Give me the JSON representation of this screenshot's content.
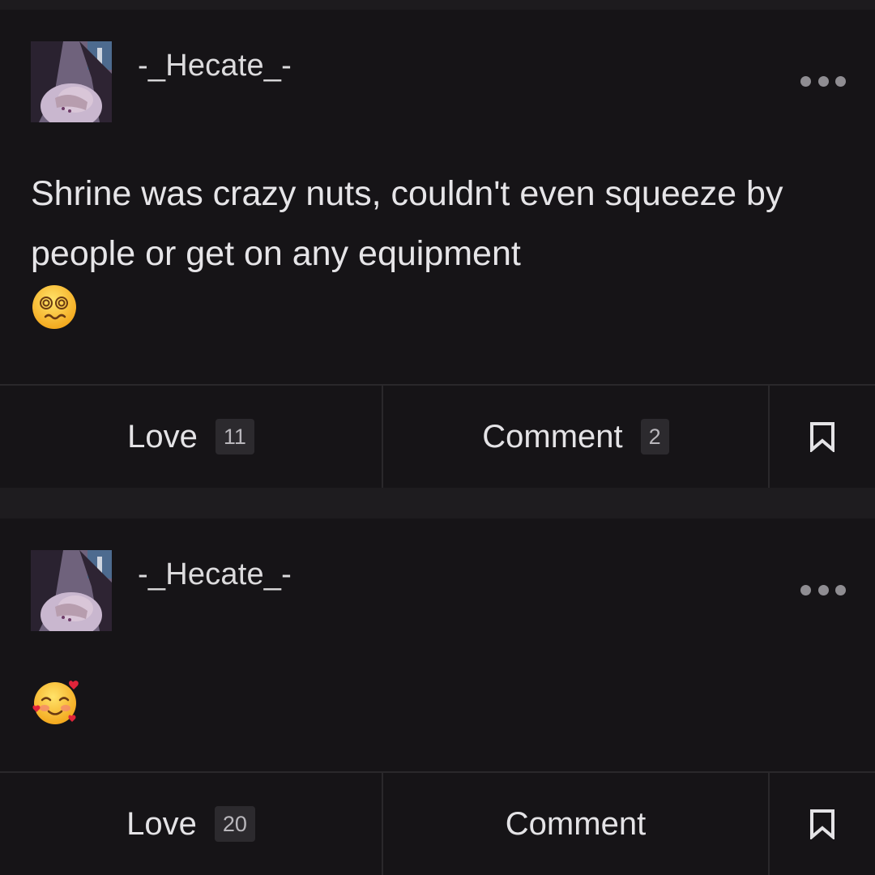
{
  "posts": [
    {
      "username": "-_Hecate_-",
      "text": "Shrine was crazy nuts, couldn't even squeeze by people or get on any equipment",
      "emoji": "dizzy-face",
      "actions": {
        "love_label": "Love",
        "love_count": "11",
        "comment_label": "Comment",
        "comment_count": "2"
      }
    },
    {
      "username": "-_Hecate_-",
      "text": "",
      "emoji": "smiling-face-with-hearts",
      "actions": {
        "love_label": "Love",
        "love_count": "20",
        "comment_label": "Comment"
      }
    }
  ],
  "icons": {
    "more": "more-horizontal-icon",
    "save": "bookmark-icon"
  },
  "colors": {
    "background": "#161417",
    "separator": "#1e1c1f",
    "badge": "#2c2a2e",
    "text": "#e6e5e8"
  }
}
